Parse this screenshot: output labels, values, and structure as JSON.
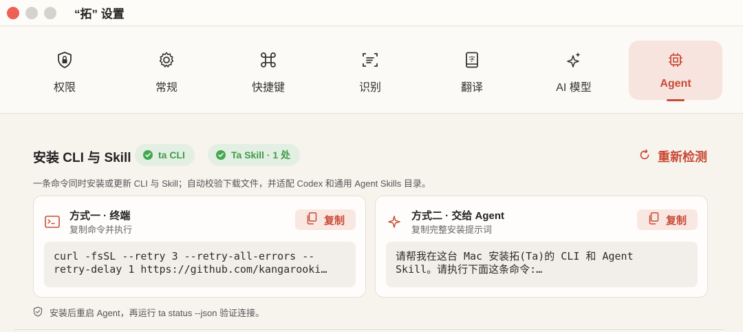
{
  "window": {
    "title": "“拓” 设置"
  },
  "toolbar": {
    "items": [
      {
        "label": "权限",
        "icon": "shield-lock-icon",
        "active": false
      },
      {
        "label": "常规",
        "icon": "gear-icon",
        "active": false
      },
      {
        "label": "快捷键",
        "icon": "command-icon",
        "active": false
      },
      {
        "label": "识别",
        "icon": "text-scan-icon",
        "active": false
      },
      {
        "label": "翻译",
        "icon": "dictionary-icon",
        "active": false
      },
      {
        "label": "AI 模型",
        "icon": "sparkles-icon",
        "active": false
      },
      {
        "label": "Agent",
        "icon": "chip-icon",
        "active": true
      }
    ]
  },
  "section": {
    "title": "安装 CLI 与 Skill",
    "badges": [
      "ta CLI",
      "Ta Skill · 1 处"
    ],
    "recheck_label": "重新检测",
    "description": "一条命令同时安装或更新 CLI 与 Skill；自动校验下载文件，并适配 Codex 和通用 Agent Skills 目录。",
    "accent_color": "#c94a35",
    "success_color": "#45a851"
  },
  "cards": [
    {
      "title": "方式一 · 终端",
      "subtitle": "复制命令并执行",
      "icon": "terminal-icon",
      "copy_label": "复制",
      "code": "curl -fsSL --retry 3 --retry-all-errors --\nretry-delay 1 https://github.com/kangarooki…"
    },
    {
      "title": "方式二 · 交给 Agent",
      "subtitle": "复制完整安装提示词",
      "icon": "sparkle-icon",
      "copy_label": "复制",
      "code": "请帮我在这台 Mac 安装拓(Ta)的 CLI 和 Agent\nSkill。请执行下面这条命令:…"
    }
  ],
  "footer": {
    "note": "安装后重启 Agent，再运行 ta status --json 验证连接。",
    "icon": "shield-check-icon"
  }
}
